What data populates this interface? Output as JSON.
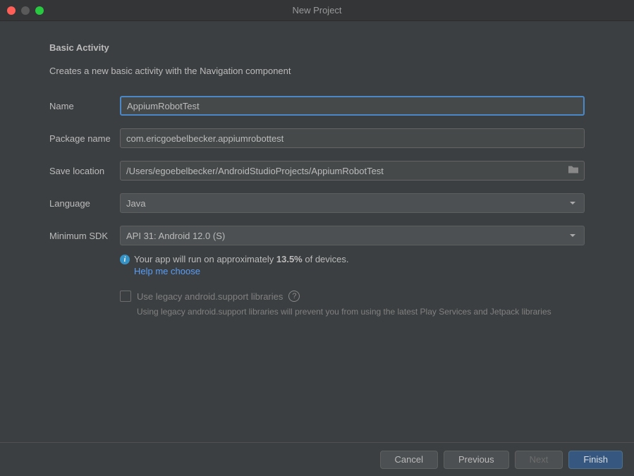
{
  "title": "New Project",
  "heading": "Basic Activity",
  "description": "Creates a new basic activity with the Navigation component",
  "labels": {
    "name": "Name",
    "package": "Package name",
    "saveLocation": "Save location",
    "language": "Language",
    "minSdk": "Minimum SDK"
  },
  "fields": {
    "name": "AppiumRobotTest",
    "package": "com.ericgoebelbecker.appiumrobottest",
    "saveLocation": "/Users/egoebelbecker/AndroidStudioProjects/AppiumRobotTest",
    "language": "Java",
    "minSdk": "API 31: Android 12.0 (S)"
  },
  "info": {
    "prefix": "Your app will run on approximately",
    "percent": "13.5%",
    "suffix": "of devices.",
    "helpLink": "Help me choose"
  },
  "legacy": {
    "label": "Use legacy android.support libraries",
    "note": "Using legacy android.support libraries will prevent you from using the latest Play Services and Jetpack libraries"
  },
  "buttons": {
    "cancel": "Cancel",
    "previous": "Previous",
    "next": "Next",
    "finish": "Finish"
  }
}
